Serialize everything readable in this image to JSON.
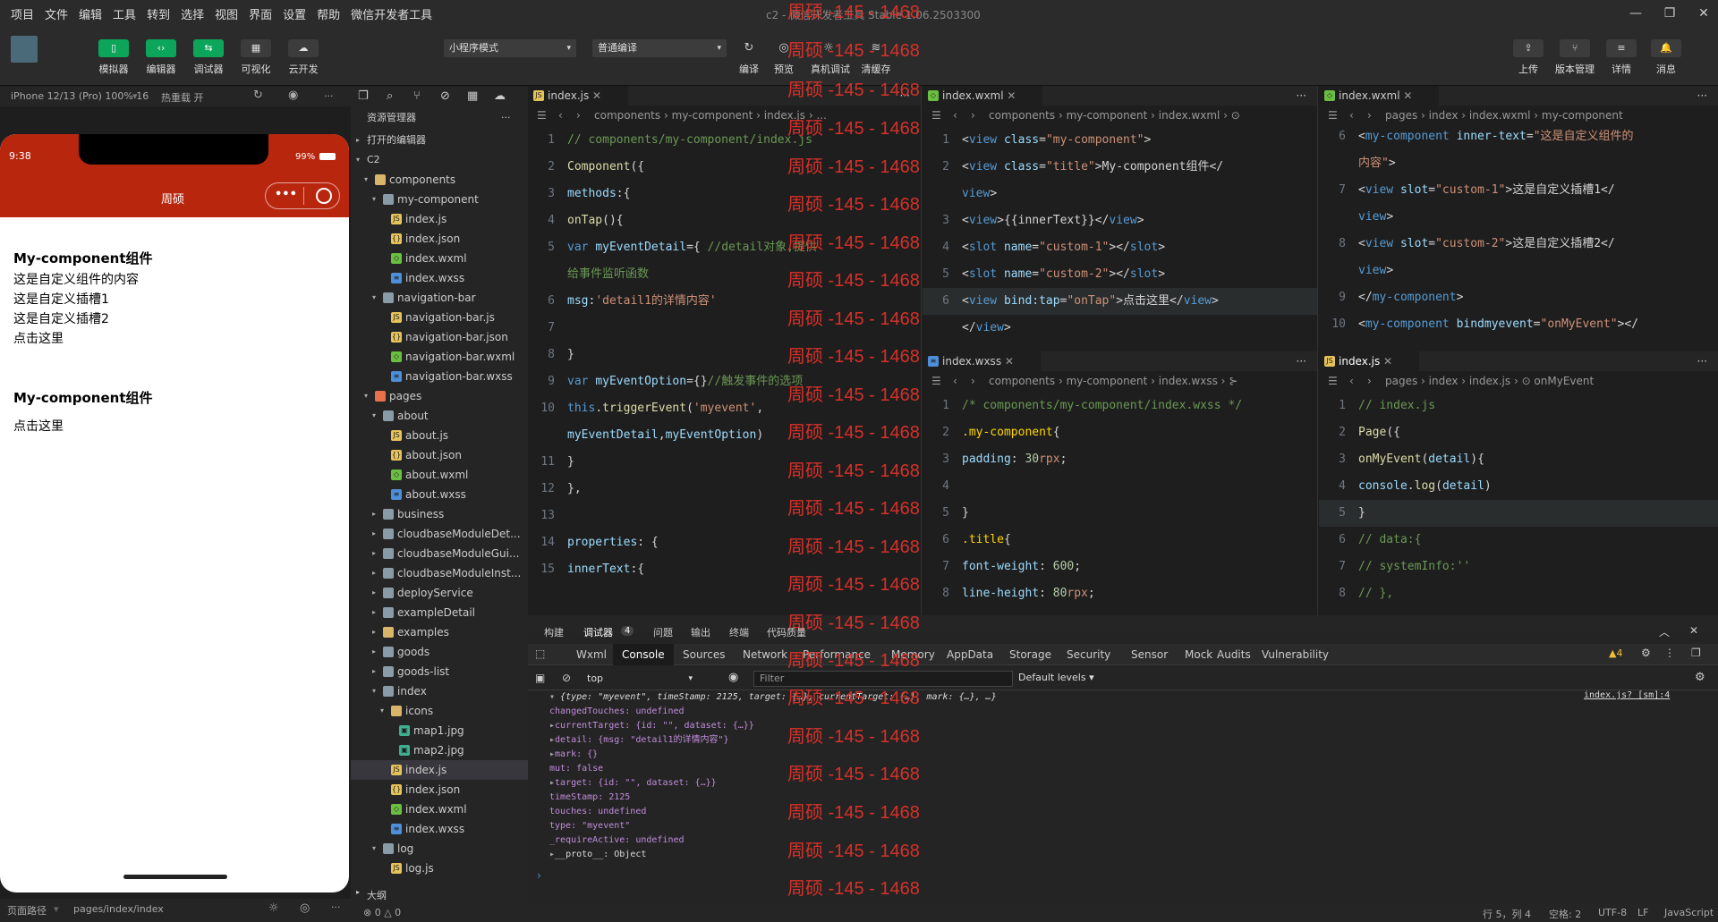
{
  "menu": {
    "items": [
      "项目",
      "文件",
      "编辑",
      "工具",
      "转到",
      "选择",
      "视图",
      "界面",
      "设置",
      "帮助",
      "微信开发者工具"
    ],
    "title": "c2 - 微信开发者工具 Stable 1.06.2503300"
  },
  "toolbar": {
    "left": [
      {
        "icon": "phone-icon",
        "label": "模拟器",
        "green": true
      },
      {
        "icon": "code-icon",
        "label": "编辑器",
        "green": true
      },
      {
        "icon": "debug-icon",
        "label": "调试器",
        "green": true
      },
      {
        "icon": "visual-icon",
        "label": "可视化",
        "green": false
      },
      {
        "icon": "cloud-icon",
        "label": "云开发",
        "green": false
      }
    ],
    "mode": "小程序模式",
    "compile": "普通编译",
    "mid": [
      {
        "icon": "refresh-icon",
        "label": "编译"
      },
      {
        "icon": "eye-icon",
        "label": "预览"
      },
      {
        "icon": "bug-icon",
        "label": "真机调试"
      },
      {
        "icon": "layers-icon",
        "label": "清缓存"
      }
    ],
    "right": [
      {
        "icon": "upload-icon",
        "label": "上传"
      },
      {
        "icon": "branch-icon",
        "label": "版本管理"
      },
      {
        "icon": "list-icon",
        "label": "详情"
      },
      {
        "icon": "bell-icon",
        "label": "消息"
      }
    ]
  },
  "simulator": {
    "device": "iPhone 12/13 (Pro) 100% 16",
    "hotreload": "热重载 开",
    "time": "9:38",
    "battery": "99%",
    "nav_title": "周硕",
    "content": [
      "My-component组件",
      "这是自定义组件的内容",
      "这是自定义插槽1",
      "这是自定义插槽2",
      "点击这里",
      "My-component组件",
      "点击这里"
    ],
    "footer_label": "页面路径",
    "footer_path": "pages/index/index"
  },
  "explorer": {
    "title": "资源管理器",
    "open_editors": "打开的编辑器",
    "root": "C2",
    "items": [
      {
        "d": 1,
        "n": "components",
        "t": "folder"
      },
      {
        "d": 2,
        "n": "my-component",
        "t": "folder"
      },
      {
        "d": 3,
        "n": "index.js",
        "t": "js"
      },
      {
        "d": 3,
        "n": "index.json",
        "t": "json"
      },
      {
        "d": 3,
        "n": "index.wxml",
        "t": "wxml"
      },
      {
        "d": 3,
        "n": "index.wxss",
        "t": "wxss"
      },
      {
        "d": 2,
        "n": "navigation-bar",
        "t": "folder"
      },
      {
        "d": 3,
        "n": "navigation-bar.js",
        "t": "js"
      },
      {
        "d": 3,
        "n": "navigation-bar.json",
        "t": "json"
      },
      {
        "d": 3,
        "n": "navigation-bar.wxml",
        "t": "wxml"
      },
      {
        "d": 3,
        "n": "navigation-bar.wxss",
        "t": "wxss"
      },
      {
        "d": 1,
        "n": "pages",
        "t": "folder"
      },
      {
        "d": 2,
        "n": "about",
        "t": "folder"
      },
      {
        "d": 3,
        "n": "about.js",
        "t": "js"
      },
      {
        "d": 3,
        "n": "about.json",
        "t": "json"
      },
      {
        "d": 3,
        "n": "about.wxml",
        "t": "wxml"
      },
      {
        "d": 3,
        "n": "about.wxss",
        "t": "wxss"
      },
      {
        "d": 2,
        "n": "business",
        "t": "cfolder"
      },
      {
        "d": 2,
        "n": "cloudbaseModuleDet...",
        "t": "cfolder"
      },
      {
        "d": 2,
        "n": "cloudbaseModuleGui...",
        "t": "cfolder"
      },
      {
        "d": 2,
        "n": "cloudbaseModuleInst...",
        "t": "cfolder"
      },
      {
        "d": 2,
        "n": "deployService",
        "t": "cfolder"
      },
      {
        "d": 2,
        "n": "exampleDetail",
        "t": "cfolder"
      },
      {
        "d": 2,
        "n": "examples",
        "t": "cfolder"
      },
      {
        "d": 2,
        "n": "goods",
        "t": "cfolder"
      },
      {
        "d": 2,
        "n": "goods-list",
        "t": "cfolder"
      },
      {
        "d": 2,
        "n": "index",
        "t": "folder"
      },
      {
        "d": 3,
        "n": "icons",
        "t": "folder"
      },
      {
        "d": 4,
        "n": "map1.jpg",
        "t": "img"
      },
      {
        "d": 4,
        "n": "map2.jpg",
        "t": "img"
      },
      {
        "d": 3,
        "n": "index.js",
        "t": "js",
        "sel": true
      },
      {
        "d": 3,
        "n": "index.json",
        "t": "json"
      },
      {
        "d": 3,
        "n": "index.wxml",
        "t": "wxml"
      },
      {
        "d": 3,
        "n": "index.wxss",
        "t": "wxss"
      },
      {
        "d": 2,
        "n": "log",
        "t": "folder"
      },
      {
        "d": 3,
        "n": "log.js",
        "t": "js"
      }
    ],
    "outline": "大纲",
    "status": "⊗ 0 △ 0"
  },
  "editor1": {
    "tab": "index.js",
    "bc": "components › my-component › index.js › ...",
    "lines": [
      [
        "1",
        [
          [
            "c",
            "// components/my-component/index.js"
          ]
        ]
      ],
      [
        "2",
        [
          [
            "f",
            "Component"
          ],
          [
            "p",
            "({"
          ]
        ]
      ],
      [
        "3",
        [
          [
            "v",
            "methods"
          ],
          [
            "p",
            ":{"
          ]
        ]
      ],
      [
        "4",
        [
          [
            "f",
            "  onTap"
          ],
          [
            "p",
            "(){"
          ]
        ]
      ],
      [
        "5",
        [
          [
            "k",
            "    var "
          ],
          [
            "v",
            "myEventDetail"
          ],
          [
            "p",
            "={ "
          ],
          [
            "c",
            "//detail对象,提供"
          ]
        ]
      ],
      [
        "",
        [
          [
            "c",
            "    给事件监听函数"
          ]
        ]
      ],
      [
        "6",
        [
          [
            "v",
            "      msg"
          ],
          [
            "p",
            ":"
          ],
          [
            "s",
            "'detail1的详情内容'"
          ]
        ]
      ],
      [
        "7",
        []
      ],
      [
        "8",
        [
          [
            "p",
            "    }"
          ]
        ]
      ],
      [
        "9",
        [
          [
            "k",
            "    var "
          ],
          [
            "v",
            "myEventOption"
          ],
          [
            "p",
            "={}"
          ],
          [
            "c",
            "//触发事件的选项"
          ]
        ]
      ],
      [
        "10",
        [
          [
            "k",
            "    this"
          ],
          [
            "p",
            "."
          ],
          [
            "f",
            "triggerEvent"
          ],
          [
            "p",
            "("
          ],
          [
            "s",
            "'myevent'"
          ],
          [
            "p",
            ","
          ]
        ]
      ],
      [
        "",
        [
          [
            "v",
            "    myEventDetail"
          ],
          [
            "p",
            ","
          ],
          [
            "v",
            "myEventOption"
          ],
          [
            "p",
            ")"
          ]
        ]
      ],
      [
        "11",
        [
          [
            "p",
            "  }"
          ]
        ]
      ],
      [
        "12",
        [
          [
            "p",
            "},"
          ]
        ]
      ],
      [
        "13",
        []
      ],
      [
        "14",
        [
          [
            "v",
            "  properties"
          ],
          [
            "p",
            ": {"
          ]
        ]
      ],
      [
        "15",
        [
          [
            "v",
            "    innerText"
          ],
          [
            "p",
            ":{"
          ]
        ]
      ]
    ]
  },
  "editor2": {
    "tab": "index.wxml",
    "bc": "components › my-component › index.wxml › ⊙",
    "lines": [
      [
        "1",
        [
          [
            "p",
            "<"
          ],
          [
            "t",
            "view "
          ],
          [
            "a",
            "class"
          ],
          [
            "p",
            "="
          ],
          [
            "s",
            "\"my-component\""
          ],
          [
            "p",
            ">"
          ]
        ]
      ],
      [
        "2",
        [
          [
            "p",
            "<"
          ],
          [
            "t",
            "view "
          ],
          [
            "a",
            "class"
          ],
          [
            "p",
            "="
          ],
          [
            "s",
            "\"title\""
          ],
          [
            "p",
            ">My-component组件</"
          ]
        ]
      ],
      [
        "",
        [
          [
            "t",
            "view"
          ],
          [
            "p",
            ">"
          ]
        ]
      ],
      [
        "3",
        [
          [
            "p",
            "<"
          ],
          [
            "t",
            "view"
          ],
          [
            "p",
            ">{{innerText}}</"
          ],
          [
            "t",
            "view"
          ],
          [
            "p",
            ">"
          ]
        ]
      ],
      [
        "4",
        [
          [
            "p",
            "<"
          ],
          [
            "t",
            "slot "
          ],
          [
            "a",
            "name"
          ],
          [
            "p",
            "="
          ],
          [
            "s",
            "\"custom-1\""
          ],
          [
            "p",
            "></"
          ],
          [
            "t",
            "slot"
          ],
          [
            "p",
            ">"
          ]
        ]
      ],
      [
        "5",
        [
          [
            "p",
            "<"
          ],
          [
            "t",
            "slot "
          ],
          [
            "a",
            "name"
          ],
          [
            "p",
            "="
          ],
          [
            "s",
            "\"custom-2\""
          ],
          [
            "p",
            "></"
          ],
          [
            "t",
            "slot"
          ],
          [
            "p",
            ">"
          ]
        ]
      ],
      [
        "6",
        [
          [
            "p",
            "<"
          ],
          [
            "t",
            "view "
          ],
          [
            "a",
            "bind:tap"
          ],
          [
            "p",
            "="
          ],
          [
            "s",
            "\"onTap\""
          ],
          [
            "p",
            ">点击这里</"
          ],
          [
            "t",
            "view"
          ],
          [
            "p",
            ">"
          ]
        ]
      ],
      [
        "",
        [
          [
            "p",
            "</"
          ],
          [
            "t",
            "view"
          ],
          [
            "p",
            ">"
          ]
        ]
      ]
    ]
  },
  "editor3": {
    "tab": "index.wxss",
    "bc": "components › my-component › index.wxss › ⊱",
    "lines": [
      [
        "1",
        [
          [
            "c",
            "/* components/my-component/index.wxss */"
          ]
        ]
      ],
      [
        "2",
        [
          [
            "y",
            ".my-component"
          ],
          [
            "p",
            "{"
          ]
        ]
      ],
      [
        "3",
        [
          [
            "a",
            "  padding"
          ],
          [
            "p",
            ": "
          ],
          [
            "n",
            "30"
          ],
          [
            "s",
            "rpx"
          ],
          [
            "p",
            ";"
          ]
        ]
      ],
      [
        "4",
        []
      ],
      [
        "5",
        [
          [
            "p",
            "}"
          ]
        ]
      ],
      [
        "6",
        [
          [
            "y",
            ".title"
          ],
          [
            "p",
            "{"
          ]
        ]
      ],
      [
        "7",
        [
          [
            "a",
            "  font-weight"
          ],
          [
            "p",
            ": "
          ],
          [
            "n",
            "600"
          ],
          [
            "p",
            ";"
          ]
        ]
      ],
      [
        "8",
        [
          [
            "a",
            "  line-height"
          ],
          [
            "p",
            ": "
          ],
          [
            "n",
            "80"
          ],
          [
            "s",
            "rpx"
          ],
          [
            "p",
            ";"
          ]
        ]
      ]
    ]
  },
  "editor4": {
    "tab": "index.wxml",
    "bc": "pages › index › index.wxml › my-component",
    "lines": [
      [
        "6",
        [
          [
            "p",
            "<"
          ],
          [
            "t",
            "my-component "
          ],
          [
            "a",
            "inner-text"
          ],
          [
            "p",
            "="
          ],
          [
            "s",
            "\"这是自定义组件的"
          ]
        ]
      ],
      [
        "",
        [
          [
            "s",
            "内容\""
          ],
          [
            "p",
            ">"
          ]
        ]
      ],
      [
        "7",
        [
          [
            "p",
            "  <"
          ],
          [
            "t",
            "view "
          ],
          [
            "a",
            "slot"
          ],
          [
            "p",
            "="
          ],
          [
            "s",
            "\"custom-1\""
          ],
          [
            "p",
            ">这是自定义插槽1</"
          ]
        ]
      ],
      [
        "",
        [
          [
            "t",
            "  view"
          ],
          [
            "p",
            ">"
          ]
        ]
      ],
      [
        "8",
        [
          [
            "p",
            "<"
          ],
          [
            "t",
            "view "
          ],
          [
            "a",
            "slot"
          ],
          [
            "p",
            "="
          ],
          [
            "s",
            "\"custom-2\""
          ],
          [
            "p",
            ">这是自定义插槽2</"
          ]
        ]
      ],
      [
        "",
        [
          [
            "t",
            "view"
          ],
          [
            "p",
            ">"
          ]
        ]
      ],
      [
        "9",
        [
          [
            "p",
            "</"
          ],
          [
            "t",
            "my-component"
          ],
          [
            "p",
            ">"
          ]
        ]
      ],
      [
        "10",
        [
          [
            "p",
            "<"
          ],
          [
            "t",
            "my-component "
          ],
          [
            "a",
            "bindmyevent"
          ],
          [
            "p",
            "="
          ],
          [
            "s",
            "\"onMyEvent\""
          ],
          [
            "p",
            "></"
          ]
        ]
      ]
    ]
  },
  "editor5": {
    "tab": "index.js",
    "bc": "pages › index › index.js › ⊙ onMyEvent",
    "lines": [
      [
        "1",
        [
          [
            "c",
            "// index.js"
          ]
        ]
      ],
      [
        "2",
        [
          [
            "f",
            "Page"
          ],
          [
            "p",
            "({"
          ]
        ]
      ],
      [
        "3",
        [
          [
            "f",
            "  onMyEvent"
          ],
          [
            "p",
            "("
          ],
          [
            "v",
            "detail"
          ],
          [
            "p",
            "){"
          ]
        ]
      ],
      [
        "4",
        [
          [
            "v",
            "    console"
          ],
          [
            "p",
            "."
          ],
          [
            "f",
            "log"
          ],
          [
            "p",
            "("
          ],
          [
            "v",
            "detail"
          ],
          [
            "p",
            ")"
          ]
        ]
      ],
      [
        "5",
        [
          [
            "p",
            "  }"
          ]
        ]
      ],
      [
        "6",
        [
          [
            "c",
            "//    data:{"
          ]
        ]
      ],
      [
        "7",
        [
          [
            "c",
            "//      systemInfo:''"
          ]
        ]
      ],
      [
        "8",
        [
          [
            "c",
            "// },"
          ]
        ]
      ]
    ]
  },
  "devtools": {
    "toptabs": [
      "构建",
      "调试器",
      "问题",
      "输出",
      "终端",
      "代码质量"
    ],
    "badge": "4",
    "tabs": [
      "Wxml",
      "Console",
      "Sources",
      "Network",
      "Performance",
      "Memory",
      "AppData",
      "Storage",
      "Security",
      "Sensor",
      "Mock",
      "Audits",
      "Vulnerability"
    ],
    "context": "top",
    "filter": "Filter",
    "levels": "Default levels",
    "warn": "▲4",
    "source": "index.js? [sm]:4",
    "console": [
      [
        "▾ ",
        "{type: \"myevent\", timeStamp: 2125, target: {…}, currentTarget: {…}, mark: {…}, …}"
      ],
      [
        "   ",
        "changedTouches: undefined"
      ],
      [
        "  ▸",
        "currentTarget: {id: \"\", dataset: {…}}"
      ],
      [
        "  ▸",
        "detail: {msg: \"detail1的详情内容\"}"
      ],
      [
        "  ▸",
        "mark: {}"
      ],
      [
        "   ",
        "mut: false"
      ],
      [
        "  ▸",
        "target: {id: \"\", dataset: {…}}"
      ],
      [
        "   ",
        "timeStamp: 2125"
      ],
      [
        "   ",
        "touches: undefined"
      ],
      [
        "   ",
        "type: \"myevent\""
      ],
      [
        "   ",
        "_requireActive: undefined"
      ],
      [
        "  ▸",
        "__proto__: Object"
      ]
    ]
  },
  "status": {
    "pos": "行 5，列 4",
    "spaces": "空格: 2",
    "enc": "UTF-8",
    "eol": "LF",
    "lang": "JavaScript"
  },
  "watermark": "周硕 -145 - 1468"
}
